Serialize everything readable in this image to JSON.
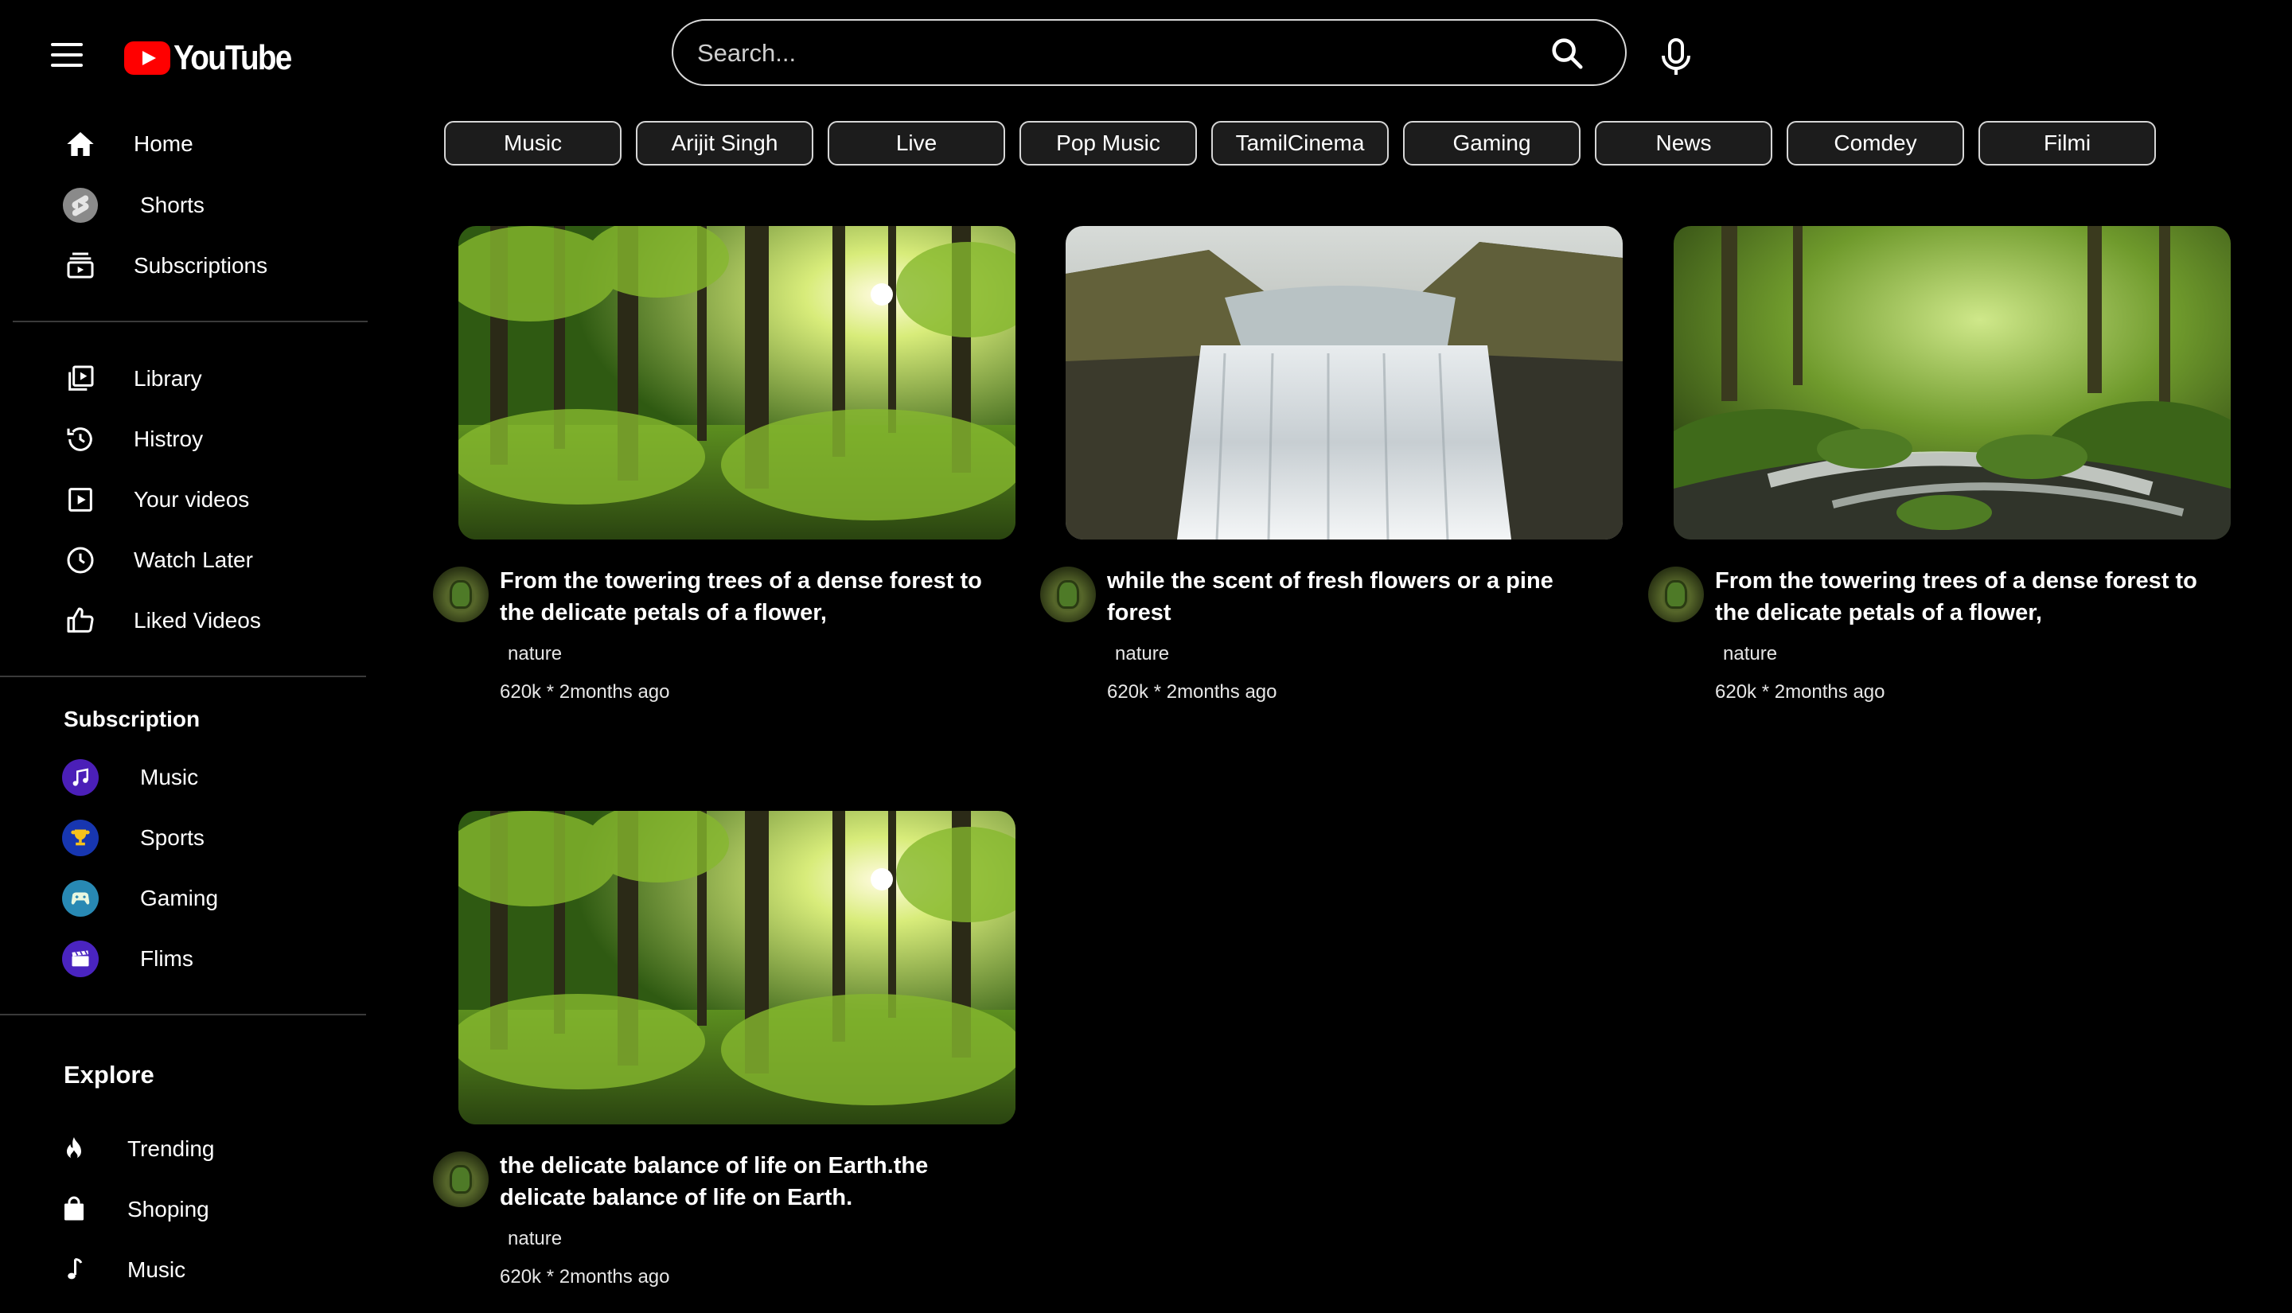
{
  "brand": {
    "logo_text": "YouTube",
    "logo_color": "#ff0000"
  },
  "search": {
    "placeholder": "Search..."
  },
  "sidebar": {
    "main": [
      {
        "label": "Home",
        "icon": "home-icon"
      },
      {
        "label": "Shorts",
        "icon": "shorts-icon"
      },
      {
        "label": "Subscriptions",
        "icon": "subscriptions-icon"
      }
    ],
    "library": [
      {
        "label": "Library",
        "icon": "library-icon"
      },
      {
        "label": "Histroy",
        "icon": "history-icon"
      },
      {
        "label": "Your videos",
        "icon": "your-videos-icon"
      },
      {
        "label": "Watch Later",
        "icon": "watch-later-icon"
      },
      {
        "label": "Liked Videos",
        "icon": "thumbs-up-icon"
      }
    ],
    "subscription_title": "Subscription",
    "subscriptions": [
      {
        "label": "Music",
        "icon": "music-note-icon",
        "color": "#5b2bd9"
      },
      {
        "label": "Sports",
        "icon": "trophy-icon",
        "color": "#1b46c9"
      },
      {
        "label": "Gaming",
        "icon": "gamepad-icon",
        "color": "#2a8fb8"
      },
      {
        "label": "Flims",
        "icon": "clapperboard-icon",
        "color": "#5a2fd6"
      }
    ],
    "explore_title": "Explore",
    "explore": [
      {
        "label": "Trending",
        "icon": "flame-icon"
      },
      {
        "label": "Shoping",
        "icon": "shopping-bag-icon"
      },
      {
        "label": "Music",
        "icon": "music-note-icon"
      }
    ]
  },
  "chips": [
    "Music",
    "Arijit Singh",
    "Live",
    "Pop Music",
    "TamilCinema",
    "Gaming",
    "News",
    "Comdey",
    "Filmi"
  ],
  "videos": [
    {
      "title": "From the towering trees of a dense forest to the delicate petals of a flower,",
      "channel": "nature",
      "meta": "620k * 2months ago",
      "thumbnail": "sunlit forest"
    },
    {
      "title": "while the scent of fresh flowers or a pine forest",
      "channel": "nature",
      "meta": "620k * 2months ago",
      "thumbnail": "waterfall"
    },
    {
      "title": "From the towering trees of a dense forest to the delicate petals of a flower,",
      "channel": "nature",
      "meta": "620k * 2months ago",
      "thumbnail": "mossy forest stream"
    },
    {
      "title": "the delicate balance of life on Earth.the delicate balance of life on Earth.",
      "channel": "nature",
      "meta": "620k * 2months ago",
      "thumbnail": "sunlit forest"
    }
  ]
}
